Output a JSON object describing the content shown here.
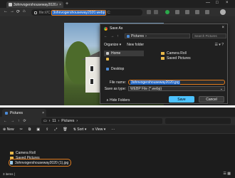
{
  "browser": {
    "tab_title": "3ohnvogershouseway2020.web...",
    "tab_close": "×",
    "new_tab": "+",
    "window_controls": [
      "—",
      "□",
      "×"
    ],
    "nav": [
      "←",
      "→",
      "⟳",
      "⌂"
    ],
    "url_prefix": "file:///C:/",
    "url_highlight": "3ohnvogershouseway2020.webp",
    "url_suffix": "C:"
  },
  "save_dialog": {
    "title": "Save As",
    "close": "×",
    "nav_arrows": [
      "←",
      "→",
      "↑"
    ],
    "breadcrumb": [
      "Pictures",
      "›"
    ],
    "search_placeholder": "Search Pictures",
    "organize": "Organize ▾",
    "new_folder": "New folder",
    "view_icons": "☰ ▾ ?",
    "nav_items": [
      {
        "label": "Home",
        "selected": true,
        "color": "#c9c9c9"
      },
      {
        "label": "",
        "selected": false,
        "color": "#e8b84a"
      },
      {
        "label": "Desktop",
        "selected": false,
        "color": "#4c8bd6"
      }
    ],
    "files": [
      "Camera Roll",
      "Saved Pictures"
    ],
    "file_name_label": "File name:",
    "file_name_value": "3ohnvogershouseway2020.jpg",
    "save_type_label": "Save as type:",
    "save_type_value": "WEBP File (*.webp)",
    "hide_folders": "∧ Hide Folders",
    "save_button": "Save",
    "cancel_button": "Cancel"
  },
  "explorer": {
    "tab_title": "Pictures",
    "tab_close": "×",
    "nav": [
      "←",
      "→",
      "↑",
      "⟳"
    ],
    "path": [
      "▭",
      "›",
      "11",
      "›",
      "Pictures",
      "›"
    ],
    "new": "⊕ New",
    "cmd_icons": [
      "✂",
      "⧉",
      "▣",
      "⇪",
      "⤢",
      "🗑"
    ],
    "sort": "⇅ Sort ▾",
    "view": "≡ View ▾",
    "more": "···",
    "files": [
      {
        "name": "Camera Roll",
        "type": "folder"
      },
      {
        "name": "Saved Pictures",
        "type": "folder"
      },
      {
        "name": "3ohnvogershouseway2020 (1).jpg",
        "type": "jpg",
        "highlighted": true
      }
    ],
    "status": "3 items  |",
    "status_icons": "☰ ▦"
  }
}
